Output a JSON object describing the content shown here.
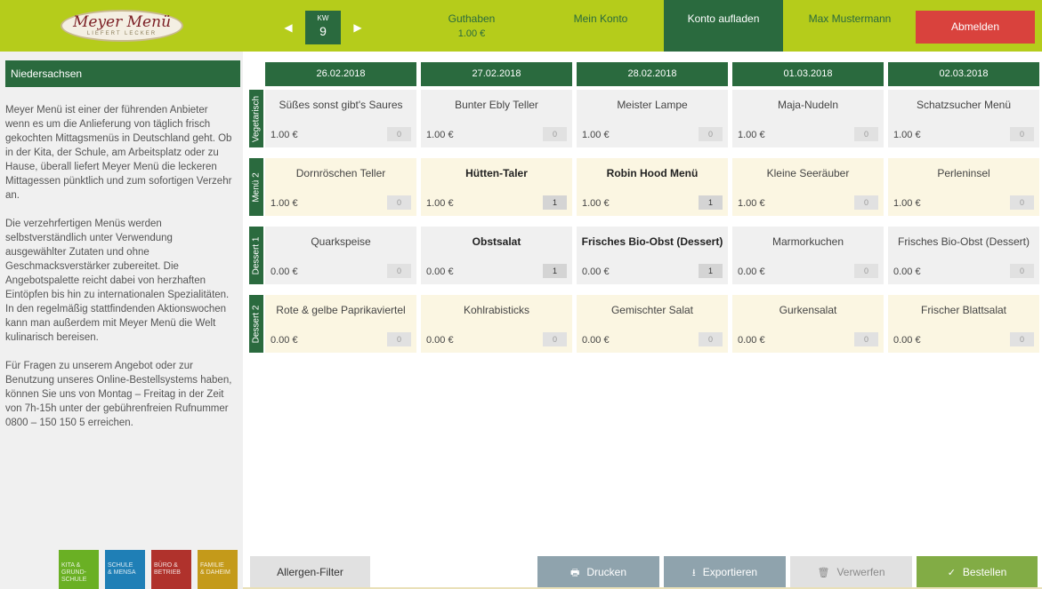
{
  "header": {
    "logo_main": "Meyer Menü",
    "logo_sub": "LIEFERT LECKER",
    "prev_icon": "chevron-left-icon",
    "next_icon": "chevron-right-icon",
    "prev_glyph": "◀",
    "next_glyph": "▶",
    "kw_label": "KW",
    "kw_value": "9",
    "guthaben_label": "Guthaben",
    "guthaben_value": "1.00 €",
    "mein_konto": "Mein Konto",
    "konto_aufladen": "Konto aufladen",
    "user_name": "Max Mustermann",
    "abmelden": "Abmelden"
  },
  "sidebar": {
    "title": "Niedersachsen",
    "paragraphs": [
      "Meyer Menü ist einer der führenden Anbieter wenn es um die Anlieferung von täglich frisch gekochten Mittagsmenüs in Deutschland geht. Ob in der Kita, der Schule, am Arbeitsplatz oder zu Hause, überall liefert Meyer Menü die leckeren Mittagessen pünktlich und zum sofortigen Verzehr an.",
      "Die verzehrfertigen Menüs werden selbstverständlich unter Verwendung ausgewählter Zutaten und ohne Geschmacksverstärker zubereitet. Die Angebotspalette reicht dabei von herzhaften Eintöpfen bis hin zu internationalen Spezialitäten. In den regelmäßig stattfindenden Aktionswochen kann man außerdem mit Meyer Menü die Welt kulinarisch bereisen.",
      "Für Fragen zu unserem Angebot oder zur Benutzung unseres Online-Bestellsystems haben, können Sie uns von Montag – Freitag in der Zeit von 7h-15h unter der gebührenfreien Rufnummer 0800 – 150 150 5 erreichen."
    ],
    "tiles": [
      {
        "line1": "KITA &",
        "line2": "GRUND-",
        "line3": "SCHULE",
        "color": "#6ab024"
      },
      {
        "line1": "SCHULE",
        "line2": "& MENSA",
        "line3": "",
        "color": "#1f7fb6"
      },
      {
        "line1": "BÜRO &",
        "line2": "BETRIEB",
        "line3": "",
        "color": "#b0322c"
      },
      {
        "line1": "FAMILIE",
        "line2": "& DAHEIM",
        "line3": "",
        "color": "#c49a1a"
      }
    ]
  },
  "menu": {
    "days": [
      "26.02.2018",
      "27.02.2018",
      "28.02.2018",
      "01.03.2018",
      "02.03.2018"
    ],
    "rows": [
      {
        "label": "Vegetarisch",
        "style": "gray",
        "items": [
          {
            "name": "Süßes sonst gibt's Saures",
            "price": "1.00 €",
            "qty": "0",
            "selected": false
          },
          {
            "name": "Bunter Ebly Teller",
            "price": "1.00 €",
            "qty": "0",
            "selected": false
          },
          {
            "name": "Meister Lampe",
            "price": "1.00 €",
            "qty": "0",
            "selected": false
          },
          {
            "name": "Maja-Nudeln",
            "price": "1.00 €",
            "qty": "0",
            "selected": false
          },
          {
            "name": "Schatzsucher Menü",
            "price": "1.00 €",
            "qty": "0",
            "selected": false
          }
        ]
      },
      {
        "label": "Menü 2",
        "style": "cream",
        "items": [
          {
            "name": "Dornröschen Teller",
            "price": "1.00 €",
            "qty": "0",
            "selected": false
          },
          {
            "name": "Hütten-Taler",
            "price": "1.00 €",
            "qty": "1",
            "selected": true
          },
          {
            "name": "Robin Hood Menü",
            "price": "1.00 €",
            "qty": "1",
            "selected": true
          },
          {
            "name": "Kleine Seeräuber",
            "price": "1.00 €",
            "qty": "0",
            "selected": false
          },
          {
            "name": "Perleninsel",
            "price": "1.00 €",
            "qty": "0",
            "selected": false
          }
        ]
      },
      {
        "label": "Dessert 1",
        "style": "gray",
        "items": [
          {
            "name": "Quarkspeise",
            "price": "0.00 €",
            "qty": "0",
            "selected": false
          },
          {
            "name": "Obstsalat",
            "price": "0.00 €",
            "qty": "1",
            "selected": true
          },
          {
            "name": "Frisches Bio-Obst (Dessert)",
            "price": "0.00 €",
            "qty": "1",
            "selected": true
          },
          {
            "name": "Marmorkuchen",
            "price": "0.00 €",
            "qty": "0",
            "selected": false
          },
          {
            "name": "Frisches Bio-Obst (Dessert)",
            "price": "0.00 €",
            "qty": "0",
            "selected": false
          }
        ]
      },
      {
        "label": "Dessert 2",
        "style": "cream",
        "items": [
          {
            "name": "Rote & gelbe Paprikaviertel",
            "price": "0.00 €",
            "qty": "0",
            "selected": false
          },
          {
            "name": "Kohlrabisticks",
            "price": "0.00 €",
            "qty": "0",
            "selected": false
          },
          {
            "name": "Gemischter Salat",
            "price": "0.00 €",
            "qty": "0",
            "selected": false
          },
          {
            "name": "Gurkensalat",
            "price": "0.00 €",
            "qty": "0",
            "selected": false
          },
          {
            "name": "Frischer Blattsalat",
            "price": "0.00 €",
            "qty": "0",
            "selected": false
          }
        ]
      }
    ]
  },
  "footer": {
    "allergen": "Allergen-Filter",
    "drucken": "Drucken",
    "drucken_icon": "printer-icon",
    "exportieren": "Exportieren",
    "exportieren_icon": "download-icon",
    "verwerfen": "Verwerfen",
    "verwerfen_icon": "trash-icon",
    "bestellen": "Bestellen",
    "bestellen_icon": "checkmark-icon"
  },
  "colors": {
    "header_bg": "#b5cc1b",
    "dark_green": "#2a6a3e",
    "logout_red": "#d9423d",
    "order_green": "#82ac45",
    "cell_gray": "#f0f0f0",
    "cell_cream": "#fbf6e2"
  }
}
